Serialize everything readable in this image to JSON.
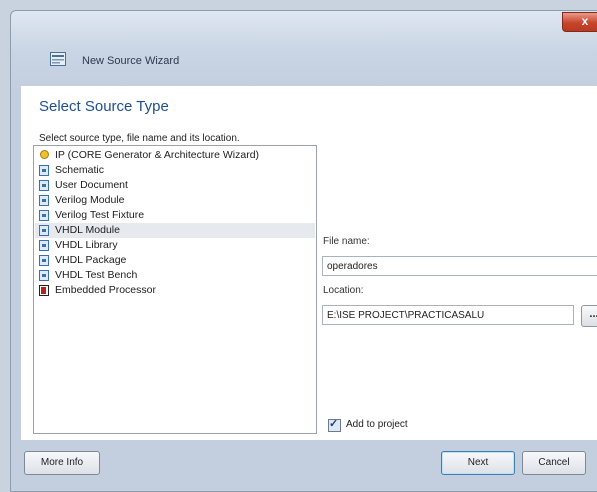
{
  "window": {
    "title": "New Source Wizard",
    "close_label": "x"
  },
  "page": {
    "heading": "Select Source Type",
    "instruction": "Select source type, file name and its location."
  },
  "source_types": [
    {
      "label": "IP (CORE Generator & Architecture Wizard)",
      "icon": "ip-core-icon",
      "selected": false
    },
    {
      "label": "Schematic",
      "icon": "schematic-icon",
      "selected": false
    },
    {
      "label": "User Document",
      "icon": "document-icon",
      "selected": false
    },
    {
      "label": "Verilog Module",
      "icon": "verilog-icon",
      "selected": false
    },
    {
      "label": "Verilog Test Fixture",
      "icon": "test-fixture-icon",
      "selected": false
    },
    {
      "label": "VHDL Module",
      "icon": "vhdl-module-icon",
      "selected": true
    },
    {
      "label": "VHDL Library",
      "icon": "vhdl-library-icon",
      "selected": false
    },
    {
      "label": "VHDL Package",
      "icon": "vhdl-package-icon",
      "selected": false
    },
    {
      "label": "VHDL Test Bench",
      "icon": "test-bench-icon",
      "selected": false
    },
    {
      "label": "Embedded Processor",
      "icon": "processor-icon",
      "selected": false
    }
  ],
  "file": {
    "name_label": "File name:",
    "name_value": "operadores",
    "location_label": "Location:",
    "location_value": "E:\\ISE PROJECT\\PRACTICASALU",
    "browse_label": "..."
  },
  "add_to_project": {
    "label": "Add to project",
    "checked": true
  },
  "buttons": {
    "more_info": "More Info",
    "next": "Next",
    "cancel": "Cancel"
  }
}
